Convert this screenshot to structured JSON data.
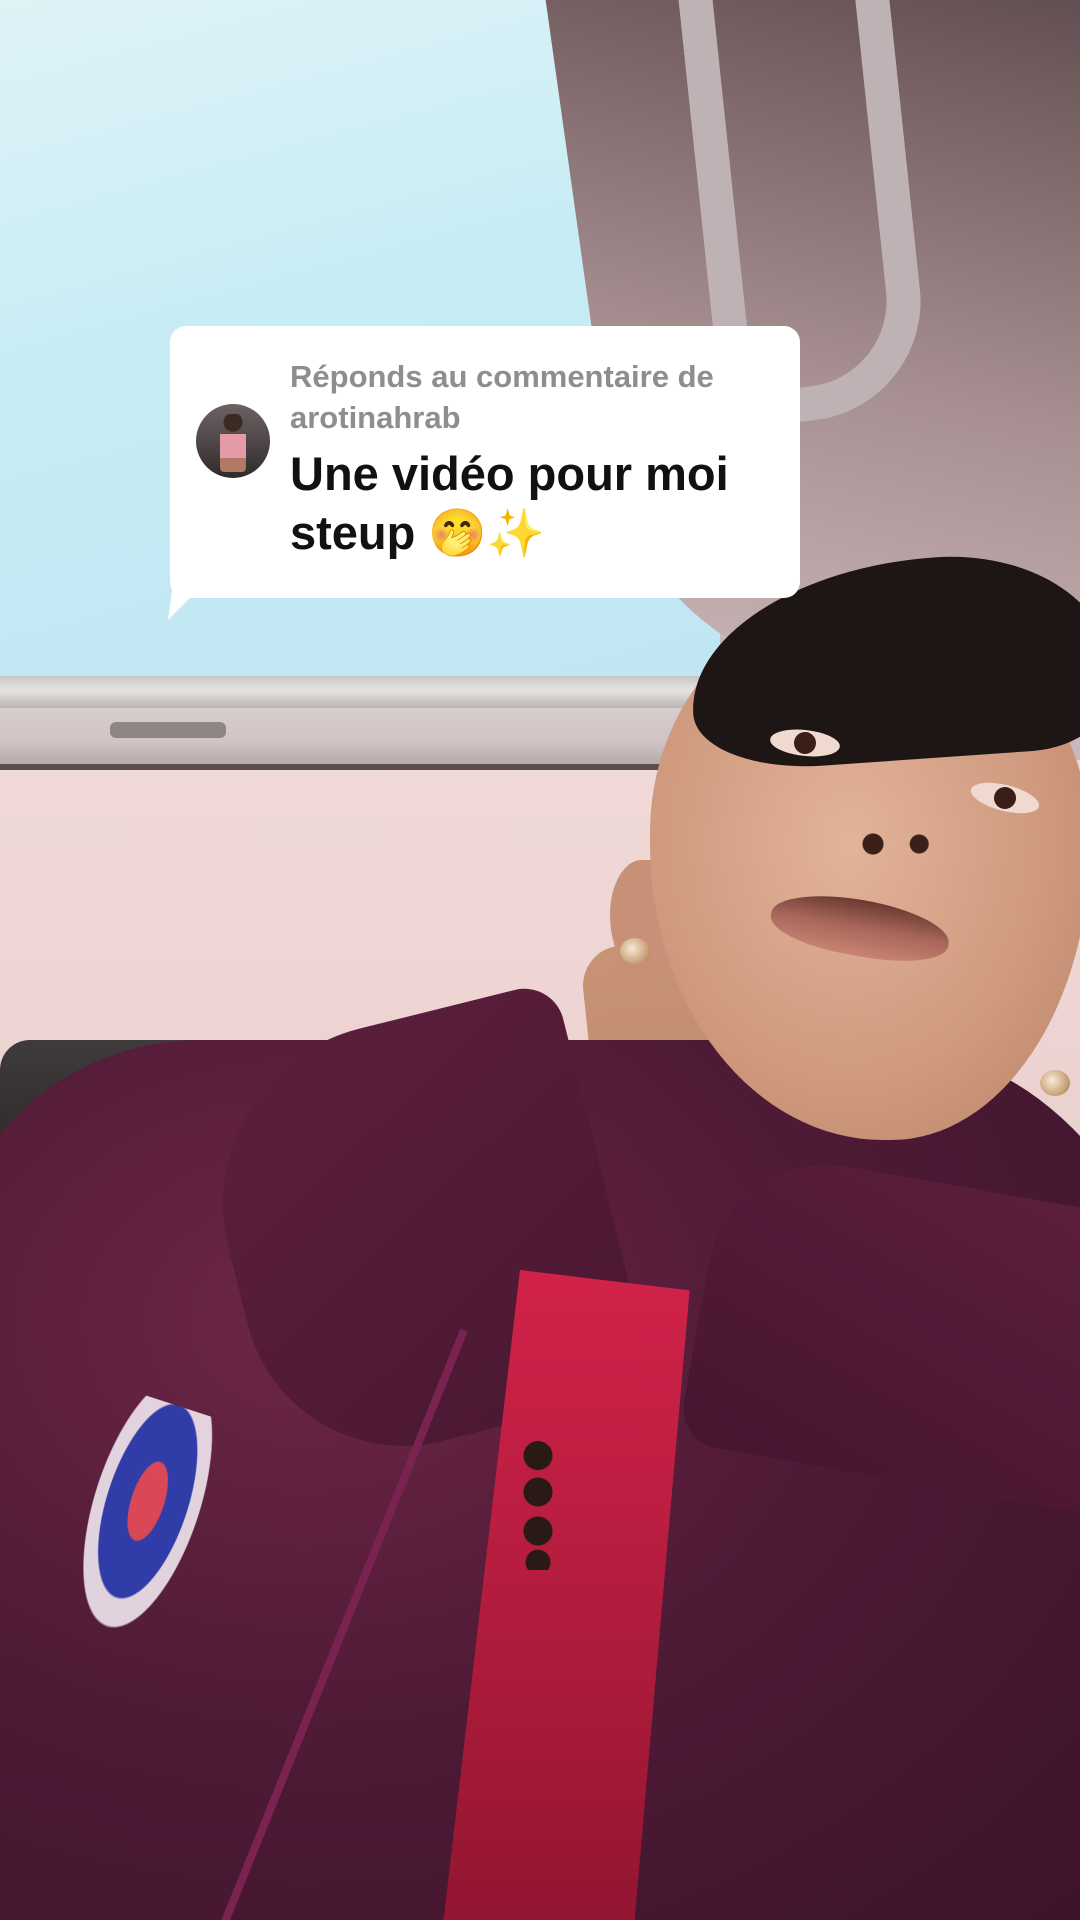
{
  "reply_sticker": {
    "prefix": "Réponds au commentaire de",
    "username": "arotinahrab",
    "comment": "Une vidéo pour moi steup 🤭✨",
    "avatar_icon": "user-avatar",
    "background_color": "#ffffff",
    "label_color": "#8e8e8e",
    "comment_color": "#111111"
  }
}
